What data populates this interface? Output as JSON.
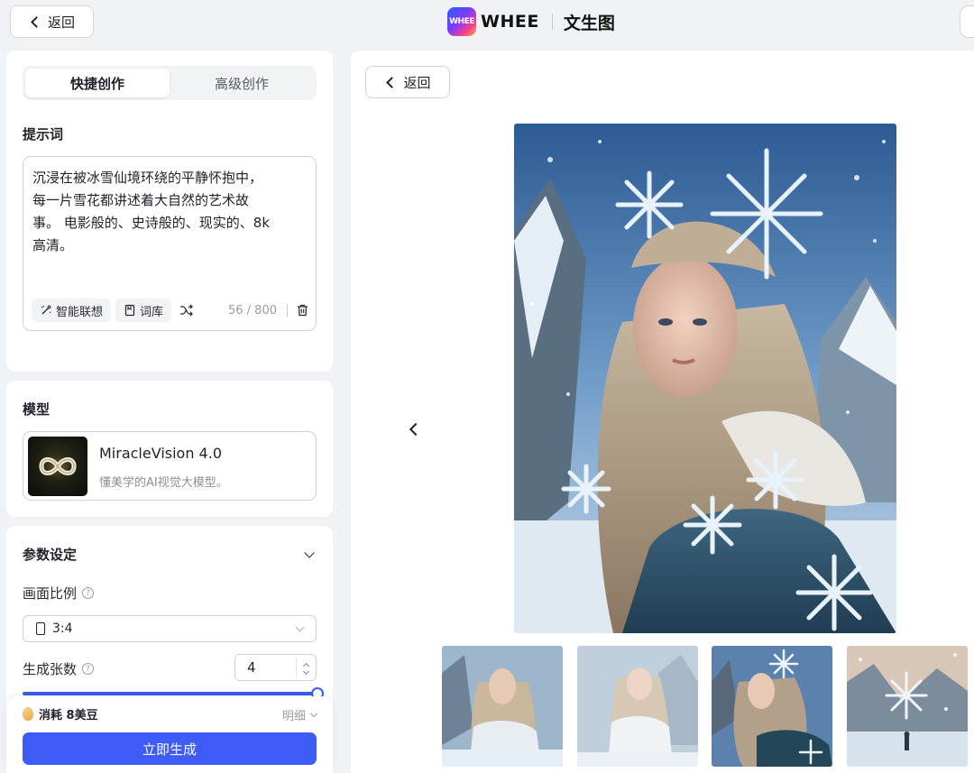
{
  "topbar": {
    "back_label": "返回",
    "logo_text": "WHEE",
    "brand_name": "WHEE",
    "page_title": "文生图"
  },
  "tabs": [
    {
      "label": "快捷创作",
      "active": true
    },
    {
      "label": "高级创作",
      "active": false
    }
  ],
  "prompt": {
    "section_title": "提示词",
    "text": "沉浸在被冰雪仙境环绕的平静怀抱中，\n每一片雪花都讲述着大自然的艺术故\n事。 电影般的、史诗般的、现实的、8k\n高清。",
    "tools": {
      "smart_assoc": "智能联想",
      "lexicon": "词库"
    },
    "counter": "56 / 800"
  },
  "model": {
    "section_title": "模型",
    "name": "MiracleVision 4.0",
    "description": "懂美学的AI视觉大模型。"
  },
  "params": {
    "section_title": "参数设定",
    "aspect_label": "画面比例",
    "aspect_value": "3:4",
    "count_label": "生成张数",
    "count_value": "4",
    "slider_level": 1.0
  },
  "footer": {
    "cost_label": "消耗 8美豆",
    "detail_label": "明细",
    "generate_label": "立即生成"
  },
  "main": {
    "back_label": "返回"
  },
  "colors": {
    "accent": "#3d5cf5",
    "background": "#f1f2f5"
  }
}
